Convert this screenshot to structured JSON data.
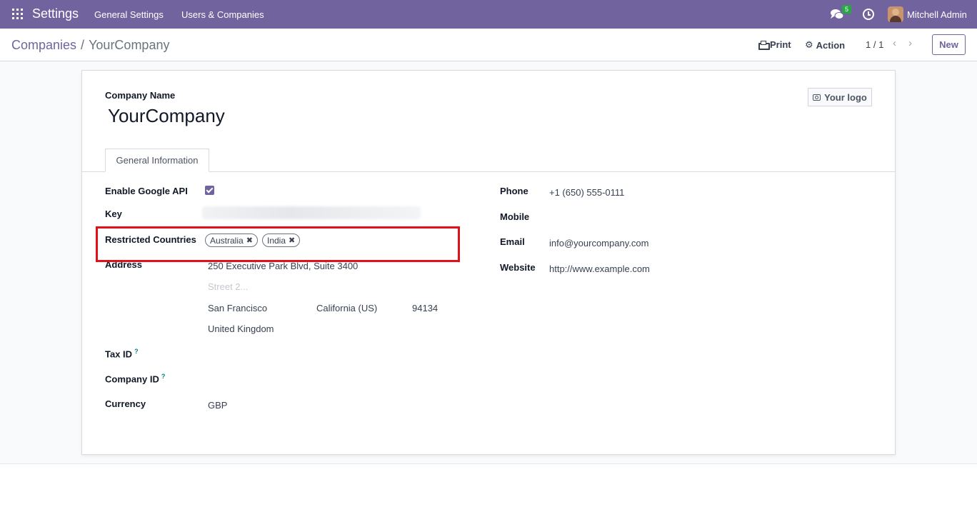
{
  "navbar": {
    "app_name": "Settings",
    "menu": [
      "General Settings",
      "Users & Companies"
    ],
    "chat_badge": "5",
    "user_name": "Mitchell Admin"
  },
  "breadcrumb": {
    "parent": "Companies",
    "separator": "/",
    "current": "YourCompany"
  },
  "control": {
    "print_label": "Print",
    "action_label": "Action",
    "pager": "1 / 1",
    "new_label": "New"
  },
  "form": {
    "company_name_label": "Company Name",
    "company_name": "YourCompany",
    "logo_label": "Your logo",
    "tab_label": "General Information",
    "google_api_label": "Enable Google API",
    "google_api_enabled": true,
    "key_label": "Key",
    "restricted_label": "Restricted Countries",
    "restricted_countries": [
      "Australia",
      "India"
    ],
    "address_label": "Address",
    "street": "250 Executive Park Blvd, Suite 3400",
    "street2_placeholder": "Street 2...",
    "city": "San Francisco",
    "state": "California (US)",
    "zip": "94134",
    "country": "United Kingdom",
    "tax_id_label": "Tax ID",
    "company_id_label": "Company ID",
    "help_mark": "?",
    "currency_label": "Currency",
    "currency": "GBP",
    "phone_label": "Phone",
    "phone": "+1 (650) 555-0111",
    "mobile_label": "Mobile",
    "mobile": "",
    "email_label": "Email",
    "email": "info@yourcompany.com",
    "website_label": "Website",
    "website": "http://www.example.com"
  },
  "colors": {
    "brand": "#71639e",
    "highlight": "#e3101a",
    "badge": "#28a745"
  }
}
